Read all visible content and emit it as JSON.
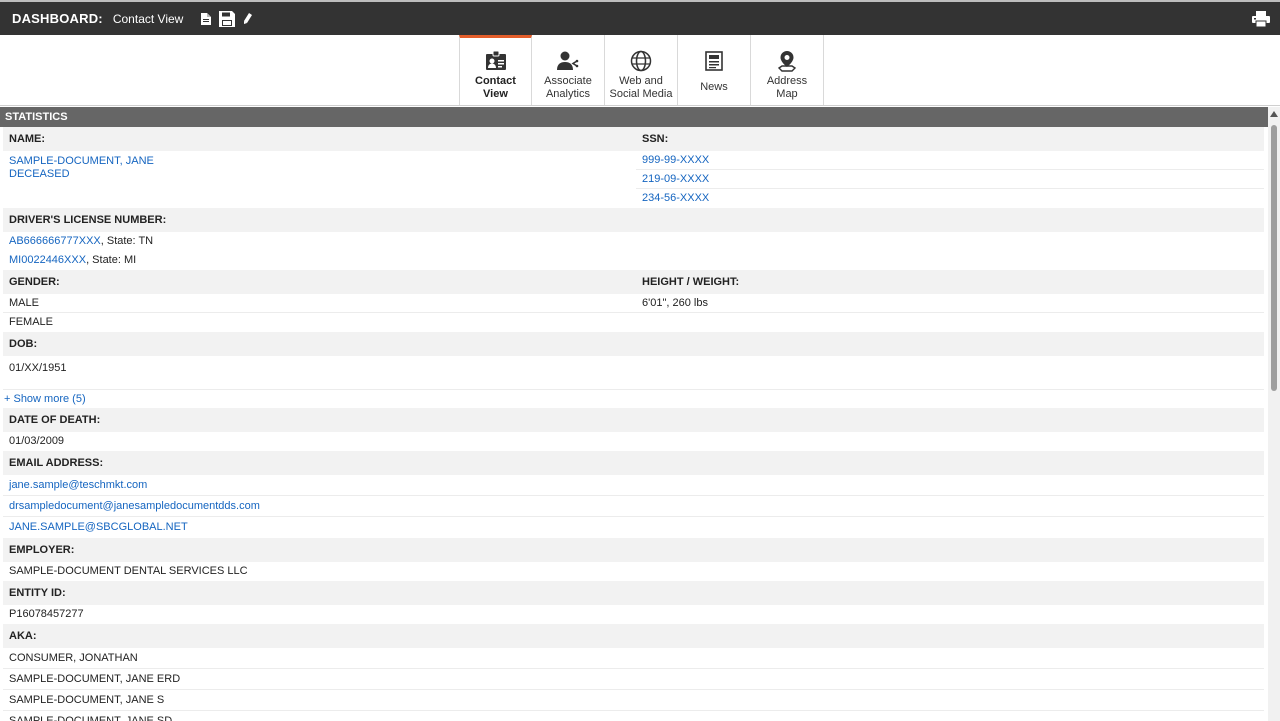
{
  "header": {
    "title": "DASHBOARD:",
    "subtitle": "Contact View"
  },
  "tabs": [
    {
      "label": "Contact\nView",
      "icon": "contact-card-icon",
      "active": true
    },
    {
      "label": "Associate\nAnalytics",
      "icon": "associate-user-icon"
    },
    {
      "label": "Web and\nSocial Media",
      "icon": "globe-icon"
    },
    {
      "label": "News",
      "icon": "newspaper-icon"
    },
    {
      "label": "Address\nMap",
      "icon": "map-pin-icon"
    }
  ],
  "section": {
    "title": "STATISTICS"
  },
  "fields": {
    "name": {
      "label": "NAME:",
      "value": "SAMPLE-DOCUMENT, JANE",
      "status": "DECEASED"
    },
    "ssn": {
      "label": "SSN:",
      "values": [
        "999-99-XXXX",
        "219-09-XXXX",
        "234-56-XXXX"
      ]
    },
    "license": {
      "label": "DRIVER'S LICENSE NUMBER:",
      "entries": [
        {
          "number": "AB666666777XXX",
          "state": ", State: TN"
        },
        {
          "number": "MI0022446XXX",
          "state": ", State: MI"
        }
      ]
    },
    "gender": {
      "label": "GENDER:",
      "values": [
        "MALE",
        "FEMALE"
      ]
    },
    "height_weight": {
      "label": "HEIGHT / WEIGHT:",
      "value": "6'01\", 260 lbs"
    },
    "dob": {
      "label": "DOB:",
      "value": "01/XX/1951"
    },
    "show_more": "+ Show more (5)",
    "date_of_death": {
      "label": "DATE OF DEATH:",
      "value": "01/03/2009"
    },
    "email": {
      "label": "EMAIL ADDRESS:",
      "values": [
        "jane.sample@teschmkt.com",
        "drsampledocument@janesampledocumentdds.com",
        "JANE.SAMPLE@SBCGLOBAL.NET"
      ]
    },
    "employer": {
      "label": "EMPLOYER:",
      "value": "SAMPLE-DOCUMENT DENTAL SERVICES LLC"
    },
    "entity_id": {
      "label": "ENTITY ID:",
      "value": "P16078457277"
    },
    "aka": {
      "label": "AKA:",
      "values": [
        "CONSUMER, JONATHAN",
        "SAMPLE-DOCUMENT, JANE ERD",
        "SAMPLE-DOCUMENT, JANE S",
        "SAMPLE-DOCUMENT, JANE SD"
      ]
    }
  },
  "colors": {
    "topbar": "#333333",
    "section_header": "#666666",
    "active_tab_accent": "#e35d2a",
    "link": "#1565c0",
    "label_row_bg": "#f2f2f2"
  }
}
